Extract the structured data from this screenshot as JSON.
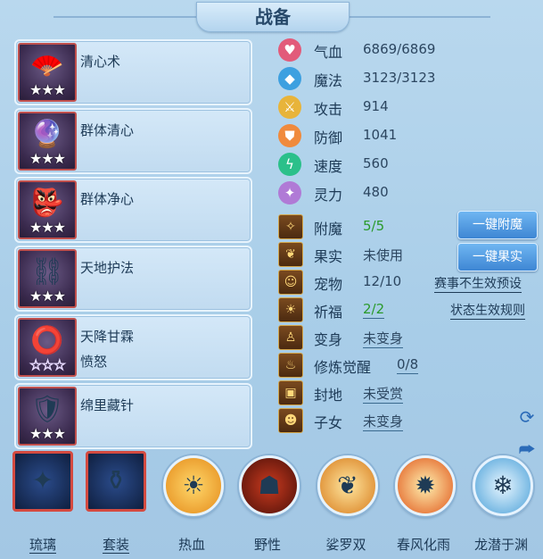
{
  "header": {
    "title": "战备"
  },
  "skills": [
    {
      "name": "清心术",
      "sub": "",
      "stars": "★★★",
      "icon": "fan-icon"
    },
    {
      "name": "群体清心",
      "sub": "",
      "stars": "★★★",
      "icon": "orb-icon"
    },
    {
      "name": "群体净心",
      "sub": "",
      "stars": "★★★",
      "icon": "mask-icon"
    },
    {
      "name": "天地护法",
      "sub": "",
      "stars": "★★★",
      "icon": "chain-icon"
    },
    {
      "name": "天降甘霖",
      "sub": "愤怒",
      "stars": "☆☆☆",
      "icon": "ring-icon"
    },
    {
      "name": "绵里藏针",
      "sub": "",
      "stars": "★★★",
      "icon": "warrior-icon"
    }
  ],
  "stats": [
    {
      "label": "气血",
      "value": "6869/6869",
      "color": "#e25b7a",
      "icon": "heart-icon"
    },
    {
      "label": "魔法",
      "value": "3123/3123",
      "color": "#3da0e0",
      "icon": "diamond-icon"
    },
    {
      "label": "攻击",
      "value": "914",
      "color": "#e8b43a",
      "icon": "sword-icon"
    },
    {
      "label": "防御",
      "value": "1041",
      "color": "#f08a3c",
      "icon": "shield-icon"
    },
    {
      "label": "速度",
      "value": "560",
      "color": "#2bc08a",
      "icon": "bolt-icon"
    },
    {
      "label": "灵力",
      "value": "480",
      "color": "#b07ad6",
      "icon": "sparkle-icon"
    }
  ],
  "misc": [
    {
      "label": "附魔",
      "value": "5/5",
      "icon": "enchant-icon",
      "green": true,
      "underline": false
    },
    {
      "label": "果实",
      "value": "未使用",
      "icon": "fruit-icon",
      "green": false,
      "underline": false
    },
    {
      "label": "宠物",
      "value": "12/10",
      "icon": "pet-icon",
      "green": false,
      "underline": false
    },
    {
      "label": "祈福",
      "value": "2/2",
      "icon": "pray-icon",
      "green": true,
      "underline": true
    },
    {
      "label": "变身",
      "value": "未变身",
      "icon": "transform-icon",
      "green": false,
      "underline": true
    },
    {
      "label": "修炼觉醒",
      "value": "0/8",
      "icon": "cultivate-icon",
      "green": false,
      "underline": true
    },
    {
      "label": "封地",
      "value": "未受赏",
      "icon": "fief-icon",
      "green": false,
      "underline": true
    },
    {
      "label": "子女",
      "value": "未变身",
      "icon": "child-icon",
      "green": false,
      "underline": true
    }
  ],
  "buttons": {
    "enchant": "一键附魔",
    "fruit": "一键果实"
  },
  "links": {
    "event_preset": "赛事不生效预设",
    "status_rules": "状态生效规则"
  },
  "bottom_tabs": [
    {
      "label": "琉璃",
      "style": "square",
      "underline": true,
      "glyph": "✦",
      "icon": "glaze-icon"
    },
    {
      "label": "套装",
      "style": "square",
      "underline": true,
      "glyph": "⚱",
      "icon": "armor-set-icon"
    },
    {
      "label": "热血",
      "style": "round",
      "underline": false,
      "glyph": "☀",
      "icon": "passion-icon"
    },
    {
      "label": "野性",
      "style": "round",
      "underline": false,
      "glyph": "☗",
      "icon": "wild-icon"
    },
    {
      "label": "娑罗双",
      "style": "round",
      "underline": false,
      "glyph": "❦",
      "icon": "sala-icon"
    },
    {
      "label": "春风化雨",
      "style": "round",
      "underline": false,
      "glyph": "✹",
      "icon": "spring-rain-icon"
    },
    {
      "label": "龙潜于渊",
      "style": "round",
      "underline": false,
      "glyph": "❄",
      "icon": "dragon-icon"
    }
  ]
}
